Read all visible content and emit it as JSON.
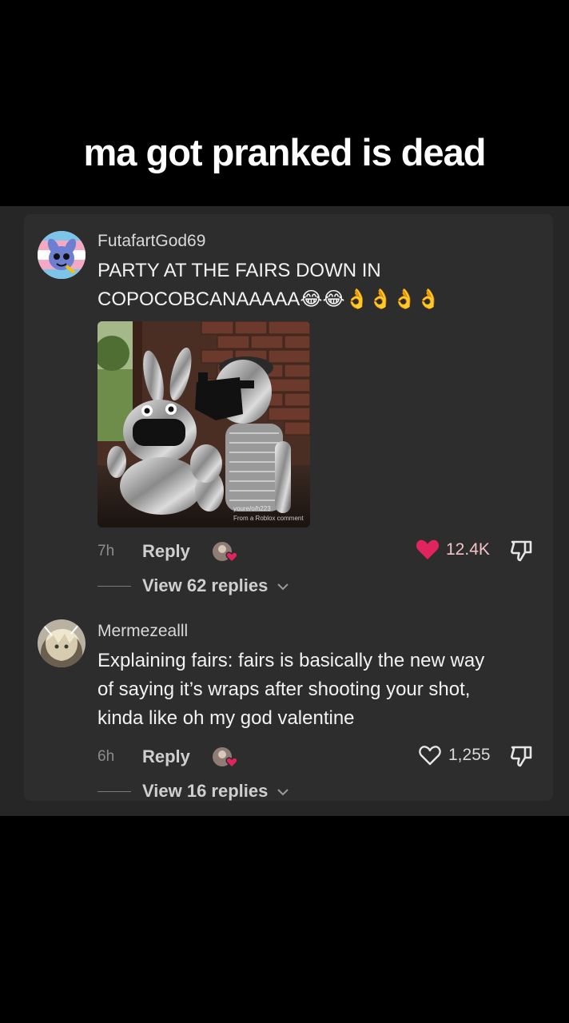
{
  "caption": "ma got pranked is dead",
  "comments": [
    {
      "username": "FutafartGod69",
      "text_line1": "PARTY AT THE FAIRS DOWN IN",
      "text_line2": "COPOCOBCANAAAAA😂😂👌👌👌👌",
      "image_watermark_line1": "youre/o/h223",
      "image_watermark_line2": "From a Roblox comment",
      "time": "7h",
      "reply_label": "Reply",
      "likes": "12.4K",
      "liked": true,
      "view_replies": "View 62 replies"
    },
    {
      "username": "Mermezealll",
      "text_lines": [
        "Explaining fairs: fairs is basically the new way",
        "of saying it’s wraps after shooting your shot,",
        "kinda like oh my god valentine"
      ],
      "time": "6h",
      "reply_label": "Reply",
      "likes": "1,255",
      "liked": false,
      "view_replies": "View 16 replies"
    }
  ],
  "colors": {
    "background": "#000000",
    "panel": "#262626",
    "card": "#2d2d2d",
    "like_active": "#e0245e",
    "like_count_active": "#f2c2c8"
  },
  "icons": [
    "heart-filled-icon",
    "heart-outline-icon",
    "dislike-icon",
    "chevron-down-icon",
    "creator-liked-badge-icon"
  ]
}
